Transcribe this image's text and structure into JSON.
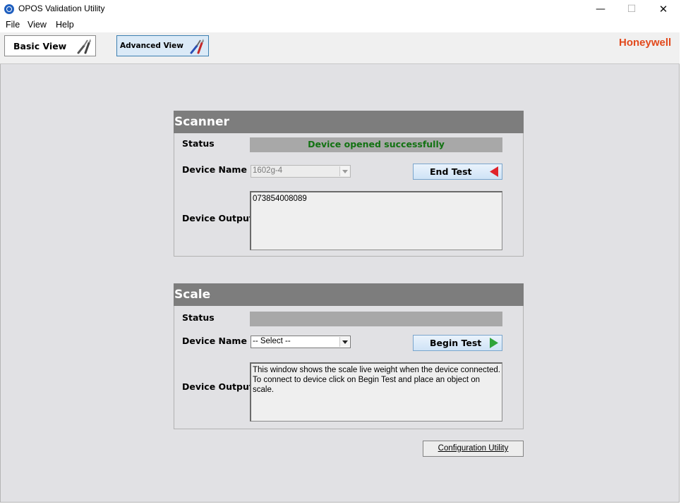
{
  "window": {
    "title": "OPOS Validation Utility",
    "minimize": "—",
    "maximize": "☐",
    "close": "✕"
  },
  "menu": [
    "File",
    "View",
    "Help"
  ],
  "toolbar": {
    "basic_view": "Basic View",
    "advanced_view": "Advanced View",
    "brand": "Honeywell"
  },
  "scanner": {
    "title": "Scanner",
    "status_label": "Status",
    "status_text": "Device opened successfully",
    "device_name_label": "Device Name",
    "device_name_value": "1602g-4",
    "action_label": "End Test",
    "device_output_label": "Device Output",
    "device_output": "073854008089"
  },
  "scale": {
    "title": "Scale",
    "status_label": "Status",
    "status_text": "",
    "device_name_label": "Device Name",
    "device_name_value": "-- Select --",
    "action_label": "Begin Test",
    "device_output_label": "Device Output",
    "device_output_lines": [
      "This window shows the scale live weight when the device connected.",
      "To connect to device click on Begin Test and place an object on scale."
    ]
  },
  "config_button": "Configuration Utility",
  "colors": {
    "brand": "#e2491c",
    "status_ok": "#127212",
    "section_header": "#7d7d7d"
  }
}
